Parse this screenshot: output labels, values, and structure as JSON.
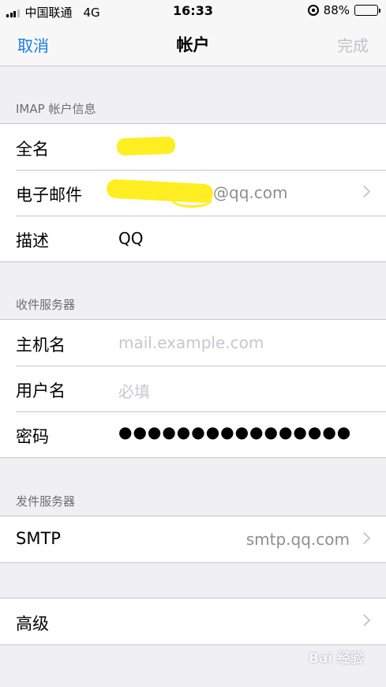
{
  "status_bar": {
    "carrier": "中国联通",
    "network": "4G",
    "time": "16:33",
    "battery_percent": "88%",
    "battery_level": 0.88
  },
  "nav": {
    "cancel_label": "取消",
    "title": "帐户",
    "done_label": "完成"
  },
  "sections": {
    "imap": {
      "header": "IMAP 帐户信息",
      "rows": [
        {
          "label": "全名",
          "value": ""
        },
        {
          "label": "电子邮件",
          "value": "@qq.com"
        },
        {
          "label": "描述",
          "value": "QQ"
        }
      ]
    },
    "incoming": {
      "header": "收件服务器",
      "rows": [
        {
          "label": "主机名",
          "placeholder": "mail.example.com"
        },
        {
          "label": "用户名",
          "placeholder": "必填"
        },
        {
          "label": "密码",
          "value": "●●●●●●●●●●●●●●●●"
        }
      ]
    },
    "outgoing": {
      "header": "发件服务器",
      "rows": [
        {
          "label": "SMTP",
          "value": "smtp.qq.com"
        }
      ]
    },
    "advanced": {
      "rows": [
        {
          "label": "高级"
        }
      ]
    }
  },
  "watermark": "Bai 经验",
  "colors": {
    "accent": "#1a7be0",
    "background": "#efeff4",
    "separator": "#c8c7cc",
    "redaction": "#ffee22"
  }
}
